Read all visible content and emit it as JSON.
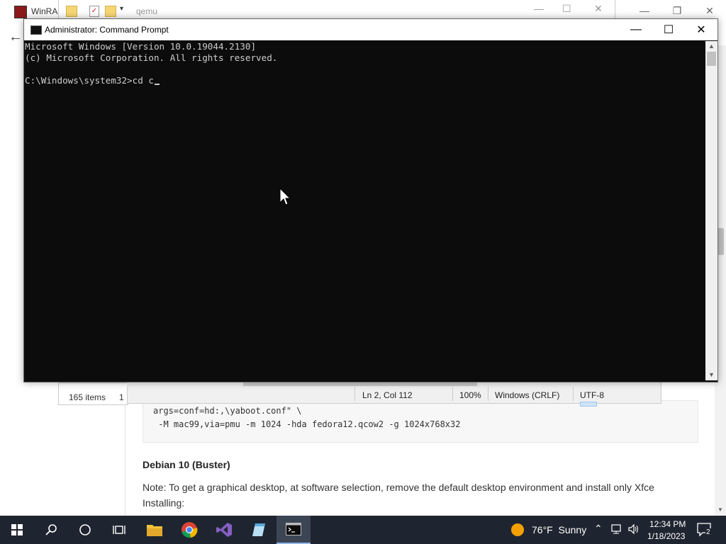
{
  "browser": {
    "code_lines": [
      "args=conf=hd:,\\yaboot.conf\" \\",
      " -M mac99,via=pmu -m 1024 -hda fedora12.qcow2 -g 1024x768x32"
    ],
    "section_heading": "Debian 10 (Buster)",
    "note": "Note: To get a graphical desktop, at software selection, remove the default desktop environment and install only Xfce",
    "installing": "Installing:"
  },
  "winrar": {
    "title": "WinRAR"
  },
  "explorer": {
    "title": "qemu",
    "status_items": "165 items",
    "status_selected": "1"
  },
  "notepad": {
    "position": "Ln 2, Col 112",
    "zoom": "100%",
    "line_ending": "Windows (CRLF)",
    "encoding": "UTF-8"
  },
  "cmd": {
    "title": "Administrator: Command Prompt",
    "lines": [
      "Microsoft Windows [Version 10.0.19044.2130]",
      "(c) Microsoft Corporation. All rights reserved.",
      "",
      "C:\\Windows\\system32>cd c"
    ]
  },
  "taskbar": {
    "weather_temp": "76°F",
    "weather_cond": "Sunny",
    "time": "12:34 PM",
    "date": "1/18/2023",
    "notification_count": "2"
  }
}
